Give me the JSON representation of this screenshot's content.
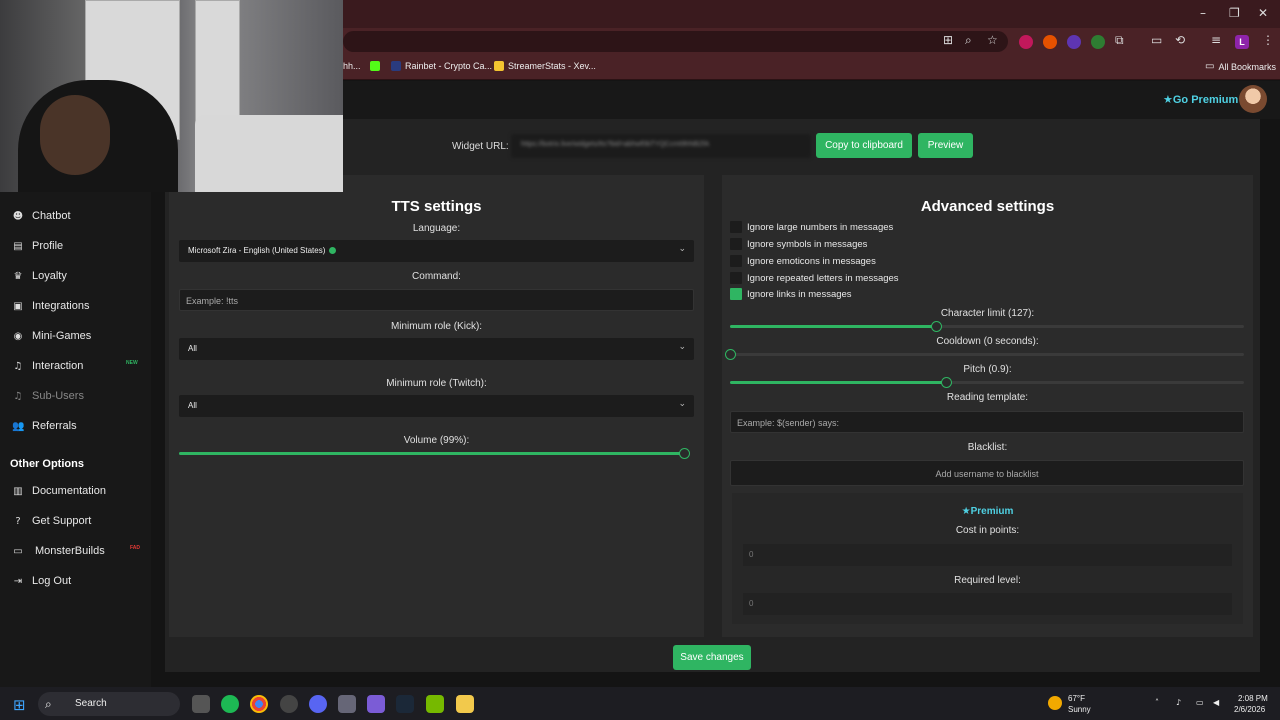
{
  "browser": {
    "bookmarks": [
      {
        "label": "hh..."
      },
      {
        "label": "Rainbet - Crypto Ca..."
      },
      {
        "label": "StreamerStats - Xev..."
      }
    ],
    "all_bookmarks": "All Bookmarks",
    "profile_initial": "L"
  },
  "header": {
    "go_premium": "Go Premium"
  },
  "sidebar": {
    "items": [
      {
        "label": "Chatbot",
        "icon": "robot-icon"
      },
      {
        "label": "Profile",
        "icon": "id-card-icon"
      },
      {
        "label": "Loyalty",
        "icon": "trophy-icon"
      },
      {
        "label": "Integrations",
        "icon": "plug-icon"
      },
      {
        "label": "Mini-Games",
        "icon": "gamepad-icon"
      },
      {
        "label": "Interaction",
        "icon": "music-icon",
        "badge": "NEW"
      },
      {
        "label": "Sub-Users",
        "icon": "music-icon"
      },
      {
        "label": "Referrals",
        "icon": "users-icon"
      }
    ],
    "other_title": "Other Options",
    "other_items": [
      {
        "label": "Documentation",
        "icon": "book-icon"
      },
      {
        "label": "Get Support",
        "icon": "question-icon"
      },
      {
        "label": "MonsterBuilds",
        "icon": "monitor-icon",
        "badge": "FAD"
      },
      {
        "label": "Log Out",
        "icon": "logout-icon"
      }
    ]
  },
  "widget": {
    "label": "Widget URL:",
    "url": "https://botrix.live/widgets/tts?bid=abhwf0bTYQCcmt9hNB2fA",
    "copy_button": "Copy to clipboard",
    "preview_button": "Preview"
  },
  "tts": {
    "title": "TTS settings",
    "language_label": "Language:",
    "language_value": "Microsoft Zira - English (United States)",
    "command_label": "Command:",
    "command_placeholder": "Example: !tts",
    "kick_role_label": "Minimum role (Kick):",
    "kick_role_value": "All",
    "twitch_role_label": "Minimum role (Twitch):",
    "twitch_role_value": "All",
    "volume_label": "Volume (99%):",
    "volume": 0.99
  },
  "advanced": {
    "title": "Advanced settings",
    "checkboxes": [
      {
        "label": "Ignore large numbers in messages",
        "checked": false
      },
      {
        "label": "Ignore symbols in messages",
        "checked": false
      },
      {
        "label": "Ignore emoticons in messages",
        "checked": false
      },
      {
        "label": "Ignore repeated letters in messages",
        "checked": false
      },
      {
        "label": "Ignore links in messages",
        "checked": true
      }
    ],
    "char_limit_label": "Character limit (127):",
    "char_limit_fraction": 0.4,
    "cooldown_label": "Cooldown (0 seconds):",
    "cooldown_fraction": 0.0,
    "pitch_label": "Pitch (0.9):",
    "pitch_fraction": 0.42,
    "reading_label": "Reading template:",
    "reading_placeholder": "Example: $(sender) says:",
    "blacklist_label": "Blacklist:",
    "blacklist_placeholder": "Add username to blacklist",
    "premium_label": "Premium",
    "cost_label": "Cost in points:",
    "cost_value": "0",
    "level_label": "Required level:",
    "level_value": "0"
  },
  "save_button": "Save changes",
  "taskbar": {
    "search": "Search",
    "weather_temp": "67°F",
    "weather_desc": "Sunny",
    "time": "2:08 PM",
    "date": "2/6/2026"
  },
  "colors": {
    "accent_green": "#2fb562",
    "premium_cyan": "#4fd1e3",
    "browser_frame": "#4a2226"
  }
}
